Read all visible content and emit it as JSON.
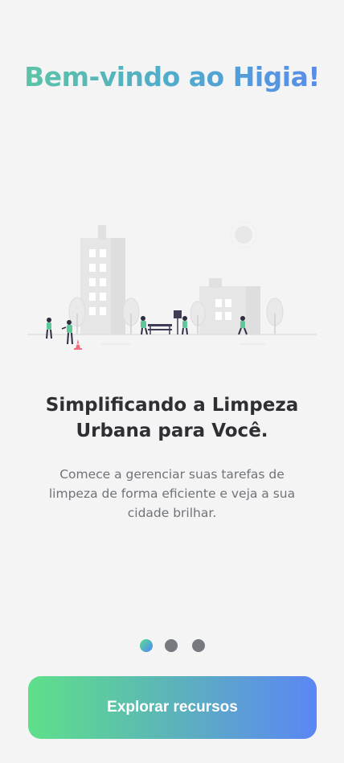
{
  "header": {
    "title": "Bem-vindo ao Higia!"
  },
  "onboarding": {
    "headline": "Simplificando a Limpeza Urbana para Você.",
    "description": "Comece a gerenciar suas tarefas de limpeza de forma eficiente e veja a sua cidade brilhar.",
    "page_indicator": {
      "total": 3,
      "current": 1
    }
  },
  "actions": {
    "explore_label": "Explorar recursos"
  },
  "colors": {
    "background": "#f4f4f5",
    "title_gradient": [
      "#5ec7a0",
      "#5b86ef"
    ],
    "button_gradient": [
      "#5ee08a",
      "#5b86f5"
    ],
    "headline": "#2d2f33",
    "body_text": "#6f7378",
    "dot_inactive": "#767a7f",
    "accent_green": "#5ec79a",
    "accent_red": "#f26d7d"
  }
}
